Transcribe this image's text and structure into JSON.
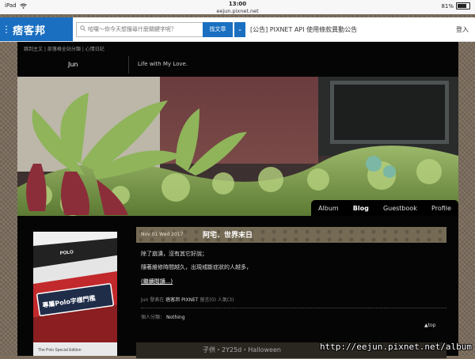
{
  "status_bar": {
    "time": "13:00",
    "url": "eejun.pixnet.net",
    "device": "iPad",
    "battery": "81%",
    "battery_fraction": 0.81
  },
  "pixnet": {
    "logo": "痞客邦",
    "search_placeholder": "哈囉～你今天想搜尋什麼關鍵字呢？",
    "search_button": "找文章",
    "dropdown_arrow": "⌄",
    "announcement": "[公告] PIXNET API 使用條款異動公告",
    "login": "登入"
  },
  "blog": {
    "nav": [
      "跳到主文",
      "部落格全站分類",
      "心情日記"
    ],
    "name": "Jun",
    "description": "Life with My Love.",
    "tabs": [
      "Album",
      "Blog",
      "Guestbook",
      "Profile"
    ],
    "active_tab": "Blog"
  },
  "post": {
    "date": "Nov 01 Wed 2017",
    "title": "阿宅．世界末日",
    "paragraphs": [
      "除了崩潰，沒有其它好說；",
      "隨著維修時間越久，出現戒斷症狀的人越多，"
    ],
    "read_more": "(繼續閱讀...)",
    "meta_prefix": "Jun 發表在",
    "meta_site": "痞客邦 PIXNET",
    "meta_comments": "留言(0)",
    "meta_views": "人氣(3)",
    "category_label": "個人分類：",
    "category": "Nothing",
    "top_link": "▲top"
  },
  "next_post": {
    "title": "子供・2Y25d・Halloween"
  },
  "sidebar_ad": {
    "brand": "POLO",
    "headline": "專屬Polo字樣門檻",
    "subtext": "The Polo Special Edition"
  },
  "watermark": "http://eejun.pixnet.net/album",
  "colors": {
    "brand_blue": "#1a6fc1",
    "blog_bg": "#050505",
    "post_header": "#756b55"
  }
}
